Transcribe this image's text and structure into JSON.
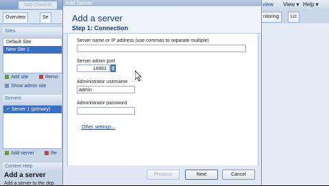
{
  "background": {
    "toolbar": {
      "ghost_button": "Add Channel"
    },
    "tabs": [
      {
        "label": "Overview"
      },
      {
        "label": "Se"
      }
    ],
    "sites": {
      "header": "Sites",
      "items": [
        "Default Site",
        "New Site 1"
      ],
      "actions": {
        "add": "Add site",
        "remove": "Remo",
        "show_admin": "Show admin site"
      }
    },
    "servers": {
      "header": "Servers",
      "items": [
        "Server 1 (primary)"
      ],
      "actions": {
        "add": "Add server",
        "remove": "Re"
      }
    },
    "context_help": {
      "header": "Context Help",
      "title": "Add a server",
      "body": "Add a server to the dep"
    },
    "right_toolbar": {
      "review": "view",
      "view_menu": "View",
      "help_menu": "Help"
    },
    "right_tabs": [
      {
        "label": "nitoring"
      },
      {
        "label": "Lic"
      }
    ]
  },
  "dialog": {
    "title": "Add Server",
    "heading": "Add a server",
    "step": "Step 1: Connection",
    "fields": {
      "server_name": {
        "label": "Server name or IP address (use commas to separate multiple)",
        "value": ""
      },
      "admin_port": {
        "label": "Server admin port",
        "value": "14983"
      },
      "admin_username": {
        "label": "Administrator username",
        "value": "admin"
      },
      "admin_password": {
        "label": "Administrator password",
        "value": ""
      }
    },
    "other_settings": "Other settings...",
    "buttons": {
      "previous": "Previous",
      "next": "Next",
      "cancel": "Cancel"
    }
  },
  "colors": {
    "accent": "#3c6fc1",
    "dialog_bg": "#dfe8f4",
    "heading": "#1e3b6a"
  }
}
